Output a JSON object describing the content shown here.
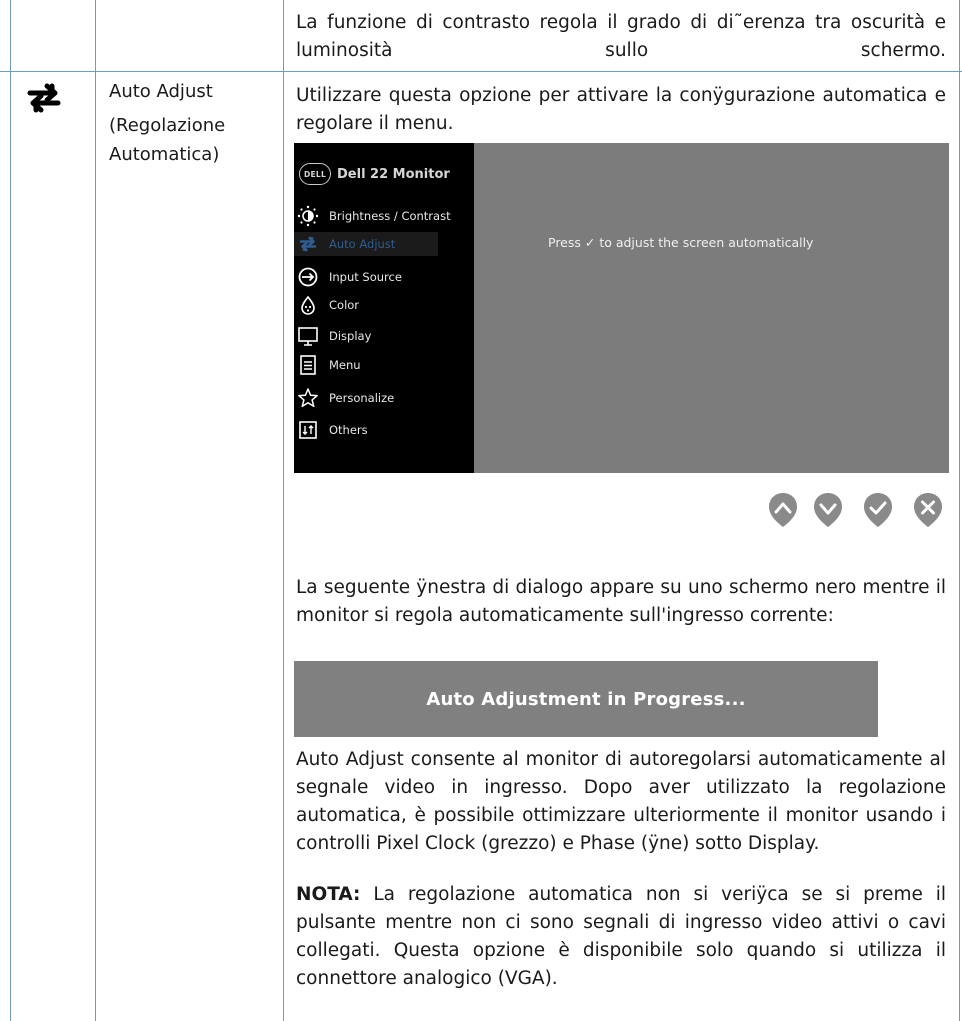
{
  "top_row": {
    "description": "La funzione di contrasto regola il grado di di˜erenza tra oscurità e luminosità sullo schermo."
  },
  "auto_adjust_row": {
    "icon": "auto-adjust-arrows-icon",
    "title": "Auto Adjust",
    "subtitle_line1": "(Regolazione",
    "subtitle_line2": "Automatica)",
    "intro": "Utilizzare questa opzione per attivare la conÿgurazione automatica e regolare il menu.",
    "osd": {
      "brand_logo_text": "DELL",
      "title": "Dell 22 Monitor",
      "menu_items": [
        {
          "label": "Brightness / Contrast",
          "icon": "brightness-icon"
        },
        {
          "label": "Auto Adjust",
          "icon": "auto-adjust-icon",
          "active": true
        },
        {
          "label": "Input Source",
          "icon": "input-source-icon"
        },
        {
          "label": "Color",
          "icon": "color-palette-icon"
        },
        {
          "label": "Display",
          "icon": "display-monitor-icon"
        },
        {
          "label": "Menu",
          "icon": "menu-list-icon"
        },
        {
          "label": "Personalize",
          "icon": "star-icon"
        },
        {
          "label": "Others",
          "icon": "others-icon"
        }
      ],
      "instruction": "Press ✓ to adjust the screen automatically",
      "colors": {
        "menu_bg": "#000000",
        "panel_bg": "#7c7c7c",
        "active_text": "#2f5d8f"
      }
    },
    "nav_buttons": [
      {
        "name": "up",
        "icon": "chevron-up-icon"
      },
      {
        "name": "down",
        "icon": "chevron-down-icon"
      },
      {
        "name": "ok",
        "icon": "checkmark-icon"
      },
      {
        "name": "exit",
        "icon": "close-icon"
      }
    ],
    "dialog_intro": "La seguente ÿnestra di dialogo appare su uno schermo nero mentre il monitor si regola automaticamente sull'ingresso corrente:",
    "dialog_text": "Auto Adjustment in Progress...",
    "body": "Auto Adjust consente al monitor di autoregolarsi automaticamente al segnale video in ingresso. Dopo aver utilizzato la regolazione automatica, è possibile ottimizzare ulteriormente il monitor usando i controlli Pixel Clock (grezzo) e Phase (ÿne) sotto Display.",
    "note_label": "NOTA:",
    "note_text": " La regolazione automatica non si veriÿca se si preme il pulsante mentre non ci sono segnali di ingresso video attivi o cavi collegati. Questa opzione è disponibile solo quando si utilizza il connettore analogico (VGA)."
  },
  "colors": {
    "table_border": "#6d9ec4",
    "nav_button": "#8a8a8a"
  }
}
